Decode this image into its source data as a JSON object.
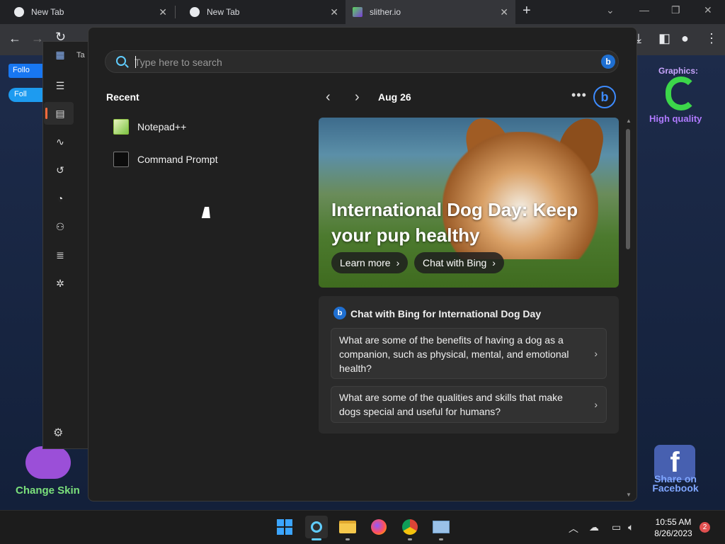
{
  "browser": {
    "tabs": [
      {
        "title": "New Tab"
      },
      {
        "title": "New Tab"
      },
      {
        "title": "slither.io"
      }
    ],
    "new_tab_symbol": "+",
    "close_symbol": "✕"
  },
  "behind_page": {
    "facebook_follow": "Follo",
    "twitter_follow": "Foll",
    "graphics_label": "Graphics:",
    "graphics_quality": "High quality",
    "change_skin": "Change Skin",
    "share_facebook": "Share on Facebook"
  },
  "behind_window": {
    "title_fragment": "Ta"
  },
  "search": {
    "placeholder": "Type here to search",
    "recent_title": "Recent",
    "recent_apps": [
      {
        "name": "Notepad++",
        "icon": "notepad-plus-plus-icon"
      },
      {
        "name": "Command Prompt",
        "icon": "command-prompt-icon"
      }
    ],
    "date": "Aug 26",
    "hero": {
      "title": "International Dog Day: Keep your pup healthy",
      "learn_more": "Learn more",
      "chat_with_bing": "Chat with Bing"
    },
    "chat_card": {
      "title": "Chat with Bing for International Dog Day",
      "questions": [
        "What are some of the benefits of having a dog as a companion, such as physical, mental, and emotional health?",
        "What are some of the qualities and skills that make dogs special and useful for humans?"
      ]
    }
  },
  "taskbar": {
    "apps": [
      "start-icon",
      "search-icon",
      "file-explorer-icon",
      "firefox-icon",
      "chrome-icon",
      "task-manager-icon"
    ],
    "time": "10:55 AM",
    "date": "8/26/2023",
    "notification_count": "2"
  },
  "colors": {
    "accent": "#60cdff",
    "bing_blue": "#1f6fd1",
    "flyout_bg": "#202020"
  }
}
